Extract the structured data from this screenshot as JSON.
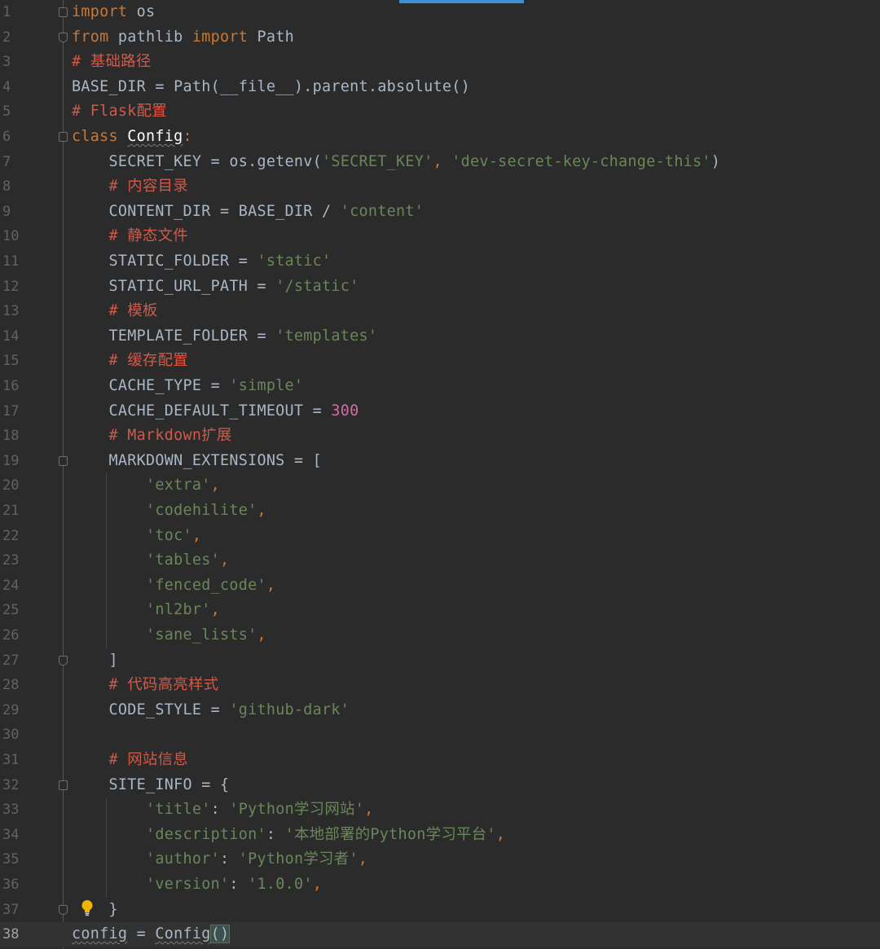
{
  "editor": {
    "lines": [
      {
        "n": "1",
        "tokens": [
          [
            "kw",
            "import"
          ],
          [
            "name",
            " os"
          ]
        ]
      },
      {
        "n": "2",
        "tokens": [
          [
            "kw",
            "from"
          ],
          [
            "name",
            " pathlib "
          ],
          [
            "kw",
            "import"
          ],
          [
            "name",
            " Path"
          ]
        ]
      },
      {
        "n": "3",
        "tokens": [
          [
            "cm",
            "# "
          ],
          [
            "cmcn",
            "基础路径"
          ]
        ]
      },
      {
        "n": "4",
        "tokens": [
          [
            "name",
            "BASE_DIR = Path(__file__).parent.absolute()"
          ]
        ]
      },
      {
        "n": "5",
        "tokens": [
          [
            "cm",
            "# Flask"
          ],
          [
            "cmcn",
            "配置"
          ]
        ]
      },
      {
        "n": "6",
        "tokens": [
          [
            "kw",
            "class "
          ],
          [
            "cls",
            "Config"
          ],
          [
            "kw",
            ":"
          ]
        ]
      },
      {
        "n": "7",
        "tokens": [
          [
            "name",
            "    SECRET_KEY = os.getenv("
          ],
          [
            "st",
            "'SECRET_KEY'"
          ],
          [
            "punc",
            ", "
          ],
          [
            "st",
            "'dev-secret-key-change-this'"
          ],
          [
            "name",
            ")"
          ]
        ]
      },
      {
        "n": "8",
        "tokens": [
          [
            "cm",
            "    # "
          ],
          [
            "cmcn",
            "内容目录"
          ]
        ]
      },
      {
        "n": "9",
        "tokens": [
          [
            "name",
            "    CONTENT_DIR = BASE_DIR / "
          ],
          [
            "st",
            "'content'"
          ]
        ]
      },
      {
        "n": "10",
        "tokens": [
          [
            "cm",
            "    # "
          ],
          [
            "cmcn",
            "静态文件"
          ]
        ]
      },
      {
        "n": "11",
        "tokens": [
          [
            "name",
            "    STATIC_FOLDER = "
          ],
          [
            "st",
            "'static'"
          ]
        ]
      },
      {
        "n": "12",
        "tokens": [
          [
            "name",
            "    STATIC_URL_PATH = "
          ],
          [
            "st",
            "'/static'"
          ]
        ]
      },
      {
        "n": "13",
        "tokens": [
          [
            "cm",
            "    # "
          ],
          [
            "cmcn",
            "模板"
          ]
        ]
      },
      {
        "n": "14",
        "tokens": [
          [
            "name",
            "    TEMPLATE_FOLDER = "
          ],
          [
            "st",
            "'templates'"
          ]
        ]
      },
      {
        "n": "15",
        "tokens": [
          [
            "cm",
            "    # "
          ],
          [
            "cmcn",
            "缓存配置"
          ]
        ]
      },
      {
        "n": "16",
        "tokens": [
          [
            "name",
            "    CACHE_TYPE = "
          ],
          [
            "st",
            "'simple'"
          ]
        ]
      },
      {
        "n": "17",
        "tokens": [
          [
            "name",
            "    CACHE_DEFAULT_TIMEOUT = "
          ],
          [
            "num",
            "300"
          ]
        ]
      },
      {
        "n": "18",
        "tokens": [
          [
            "cm",
            "    # Markdown"
          ],
          [
            "cmcn",
            "扩展"
          ]
        ]
      },
      {
        "n": "19",
        "tokens": [
          [
            "name",
            "    MARKDOWN_EXTENSIONS = ["
          ]
        ]
      },
      {
        "n": "20",
        "tokens": [
          [
            "name",
            "        "
          ],
          [
            "st",
            "'extra'"
          ],
          [
            "punc",
            ","
          ]
        ]
      },
      {
        "n": "21",
        "tokens": [
          [
            "name",
            "        "
          ],
          [
            "st",
            "'codehilite'"
          ],
          [
            "punc",
            ","
          ]
        ]
      },
      {
        "n": "22",
        "tokens": [
          [
            "name",
            "        "
          ],
          [
            "st",
            "'toc'"
          ],
          [
            "punc",
            ","
          ]
        ]
      },
      {
        "n": "23",
        "tokens": [
          [
            "name",
            "        "
          ],
          [
            "st",
            "'tables'"
          ],
          [
            "punc",
            ","
          ]
        ]
      },
      {
        "n": "24",
        "tokens": [
          [
            "name",
            "        "
          ],
          [
            "st",
            "'fenced_code'"
          ],
          [
            "punc",
            ","
          ]
        ]
      },
      {
        "n": "25",
        "tokens": [
          [
            "name",
            "        "
          ],
          [
            "st",
            "'nl2br'"
          ],
          [
            "punc",
            ","
          ]
        ]
      },
      {
        "n": "26",
        "tokens": [
          [
            "name",
            "        "
          ],
          [
            "st",
            "'sane_lists'"
          ],
          [
            "punc",
            ","
          ]
        ]
      },
      {
        "n": "27",
        "tokens": [
          [
            "name",
            "    ]"
          ]
        ]
      },
      {
        "n": "28",
        "tokens": [
          [
            "cm",
            "    # "
          ],
          [
            "cmcn",
            "代码高亮样式"
          ]
        ]
      },
      {
        "n": "29",
        "tokens": [
          [
            "name",
            "    CODE_STYLE = "
          ],
          [
            "st",
            "'github-dark'"
          ]
        ]
      },
      {
        "n": "30",
        "tokens": []
      },
      {
        "n": "31",
        "tokens": [
          [
            "cm",
            "    # "
          ],
          [
            "cmcn",
            "网站信息"
          ]
        ]
      },
      {
        "n": "32",
        "tokens": [
          [
            "name",
            "    SITE_INFO = {"
          ]
        ]
      },
      {
        "n": "33",
        "tokens": [
          [
            "name",
            "        "
          ],
          [
            "st",
            "'title'"
          ],
          [
            "name",
            ": "
          ],
          [
            "st",
            "'Python学习网站'"
          ],
          [
            "punc",
            ","
          ]
        ]
      },
      {
        "n": "34",
        "tokens": [
          [
            "name",
            "        "
          ],
          [
            "st",
            "'description'"
          ],
          [
            "name",
            ": "
          ],
          [
            "st",
            "'本地部署的Python学习平台'"
          ],
          [
            "punc",
            ","
          ]
        ]
      },
      {
        "n": "35",
        "tokens": [
          [
            "name",
            "        "
          ],
          [
            "st",
            "'author'"
          ],
          [
            "name",
            ": "
          ],
          [
            "st",
            "'Python学习者'"
          ],
          [
            "punc",
            ","
          ]
        ]
      },
      {
        "n": "36",
        "tokens": [
          [
            "name",
            "        "
          ],
          [
            "st",
            "'version'"
          ],
          [
            "name",
            ": "
          ],
          [
            "st",
            "'1.0.0'"
          ],
          [
            "punc",
            ","
          ]
        ]
      },
      {
        "n": "37",
        "tokens": [
          [
            "name",
            "    }"
          ]
        ]
      },
      {
        "n": "38",
        "tokens": [
          [
            "sq",
            "config"
          ],
          [
            "name",
            " = "
          ],
          [
            "sq2",
            "Config"
          ],
          [
            "br",
            "()"
          ]
        ]
      }
    ]
  },
  "colors": {
    "background": "#2b2b2b",
    "keyword": "#cc7832",
    "string": "#6a8759",
    "number": "#d16da8",
    "comment": "#cf5a4a",
    "identifier": "#a9b7c6",
    "line_number": "#606366",
    "current_line": "#323232",
    "tab_indicator": "#3d8fd6"
  },
  "icons": {
    "intention_bulb": "lightbulb-icon",
    "fold_marker": "fold-icon"
  }
}
